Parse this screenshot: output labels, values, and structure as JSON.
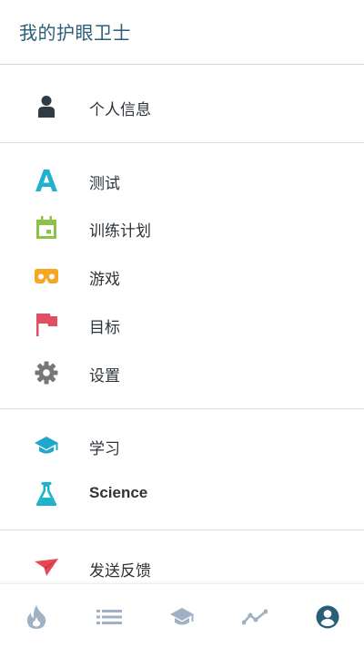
{
  "app": {
    "title": "我的护眼卫士"
  },
  "colors": {
    "title": "#2c5e78",
    "profile_icon": "#2f3b45",
    "test_icon": "#1fb2cc",
    "training_icon": "#8bc34a",
    "game_icon": "#f5a623",
    "goal_icon": "#e05060",
    "settings_icon": "#777777",
    "study_icon": "#1fa8c9",
    "science_icon": "#1fb2cc",
    "feedback_icon": "#e84855",
    "nav_inactive": "#9fb1c2",
    "nav_active": "#2c5e78"
  },
  "menu": {
    "profile": {
      "label": "个人信息",
      "icon": "person-icon"
    },
    "test": {
      "label": "测试",
      "icon": "letter-a-icon"
    },
    "training": {
      "label": "训练计划",
      "icon": "calendar-icon"
    },
    "game": {
      "label": "游戏",
      "icon": "vr-goggles-icon"
    },
    "goal": {
      "label": "目标",
      "icon": "flag-icon"
    },
    "settings": {
      "label": "设置",
      "icon": "gear-icon"
    },
    "study": {
      "label": "学习",
      "icon": "graduation-cap-icon"
    },
    "science": {
      "label": "Science",
      "icon": "flask-icon"
    },
    "feedback": {
      "label": "发送反馈",
      "icon": "send-icon"
    }
  },
  "bottom_nav": {
    "tabs": [
      {
        "icon": "flame-icon",
        "active": false
      },
      {
        "icon": "list-icon",
        "active": false
      },
      {
        "icon": "graduation-cap-icon",
        "active": false
      },
      {
        "icon": "trend-line-icon",
        "active": false
      },
      {
        "icon": "account-circle-icon",
        "active": true
      }
    ]
  }
}
